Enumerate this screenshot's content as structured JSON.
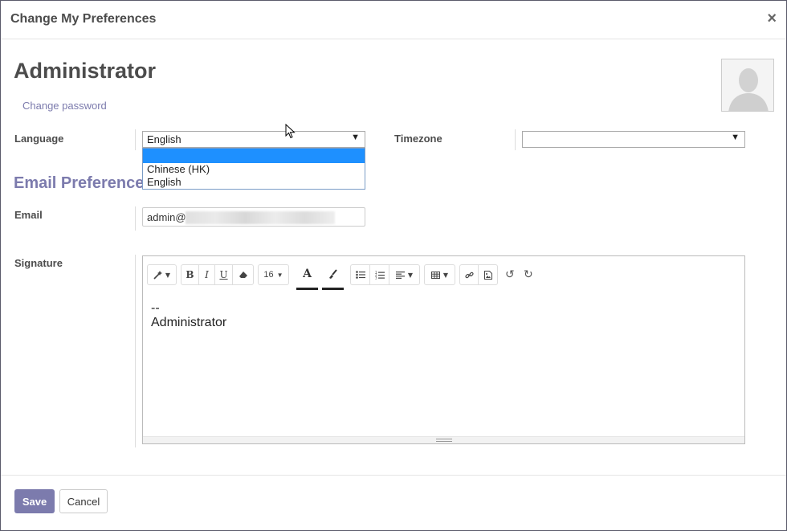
{
  "dialog": {
    "title": "Change My Preferences",
    "close_icon": "×"
  },
  "user": {
    "name": "Administrator",
    "change_password": "Change password"
  },
  "fields": {
    "language_label": "Language",
    "language_value": "English",
    "language_options": [
      "",
      "Chinese (HK)",
      "English"
    ],
    "timezone_label": "Timezone",
    "timezone_value": "",
    "email_section": "Email Preferences",
    "email_label": "Email",
    "email_value": "admin@",
    "signature_label": "Signature"
  },
  "editor": {
    "font_size": "16",
    "text_color_glyph": "A",
    "signature_lines": [
      "--",
      "Administrator"
    ]
  },
  "actions": {
    "save": "Save",
    "cancel": "Cancel"
  },
  "colors": {
    "accent": "#7c7bad",
    "highlight": "#1e90ff"
  }
}
